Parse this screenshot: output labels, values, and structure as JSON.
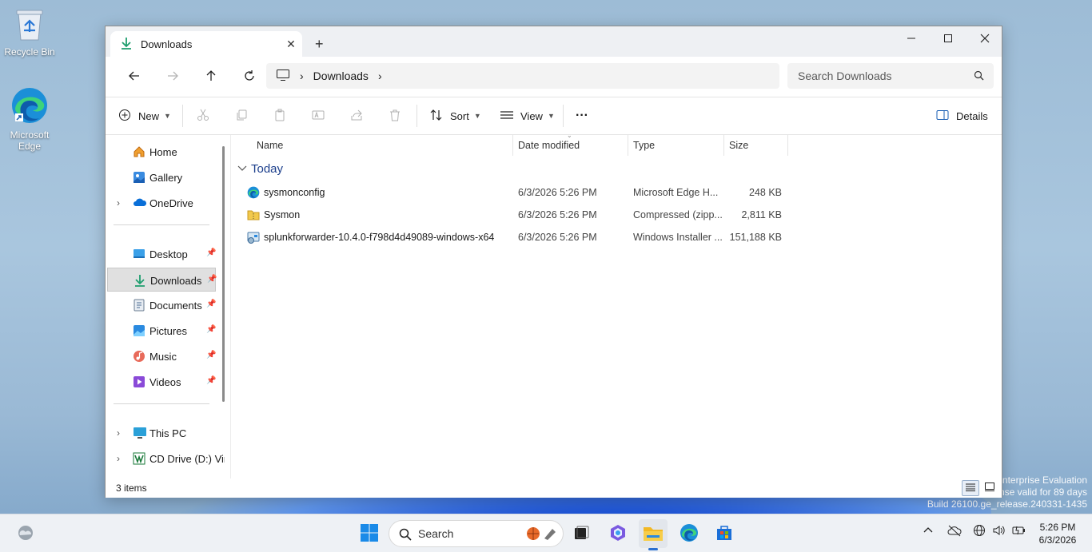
{
  "desktop": {
    "icons": [
      {
        "label": "Recycle Bin"
      },
      {
        "label": "Microsoft Edge"
      }
    ],
    "watermark": [
      "Enterprise Evaluation",
      "nse valid for 89 days",
      "Build 26100.ge_release.240331-1435"
    ]
  },
  "window": {
    "tab_title": "Downloads",
    "tab_close": "✕",
    "new_tab": "+",
    "address": {
      "crumb": "Downloads",
      "sep": "›"
    },
    "search": {
      "placeholder": "Search Downloads"
    },
    "toolbar": {
      "new_label": "New",
      "sort_label": "Sort",
      "view_label": "View",
      "more_label": "···",
      "details_label": "Details"
    },
    "sidebar": {
      "items": [
        {
          "label": "Home"
        },
        {
          "label": "Gallery"
        },
        {
          "label": "OneDrive"
        },
        {
          "label": "Desktop"
        },
        {
          "label": "Downloads"
        },
        {
          "label": "Documents"
        },
        {
          "label": "Pictures"
        },
        {
          "label": "Music"
        },
        {
          "label": "Videos"
        },
        {
          "label": "This PC"
        },
        {
          "label": "CD Drive (D:) Vir"
        }
      ],
      "pin": "📌",
      "chevron": "›"
    },
    "columns": [
      "Name",
      "Date modified",
      "Type",
      "Size"
    ],
    "group_label": "Today",
    "files": [
      {
        "name": "sysmonconfig",
        "date": "6/3/2026 5:26 PM",
        "type": "Microsoft Edge H...",
        "size": "248 KB"
      },
      {
        "name": "Sysmon",
        "date": "6/3/2026 5:26 PM",
        "type": "Compressed (zipp...",
        "size": "2,811 KB"
      },
      {
        "name": "splunkforwarder-10.4.0-f798d4d49089-windows-x64",
        "date": "6/3/2026 5:26 PM",
        "type": "Windows Installer ...",
        "size": "151,188 KB"
      }
    ],
    "status": "3 items"
  },
  "taskbar": {
    "search_placeholder": "Search",
    "time": "5:26 PM",
    "date": "6/3/2026"
  }
}
